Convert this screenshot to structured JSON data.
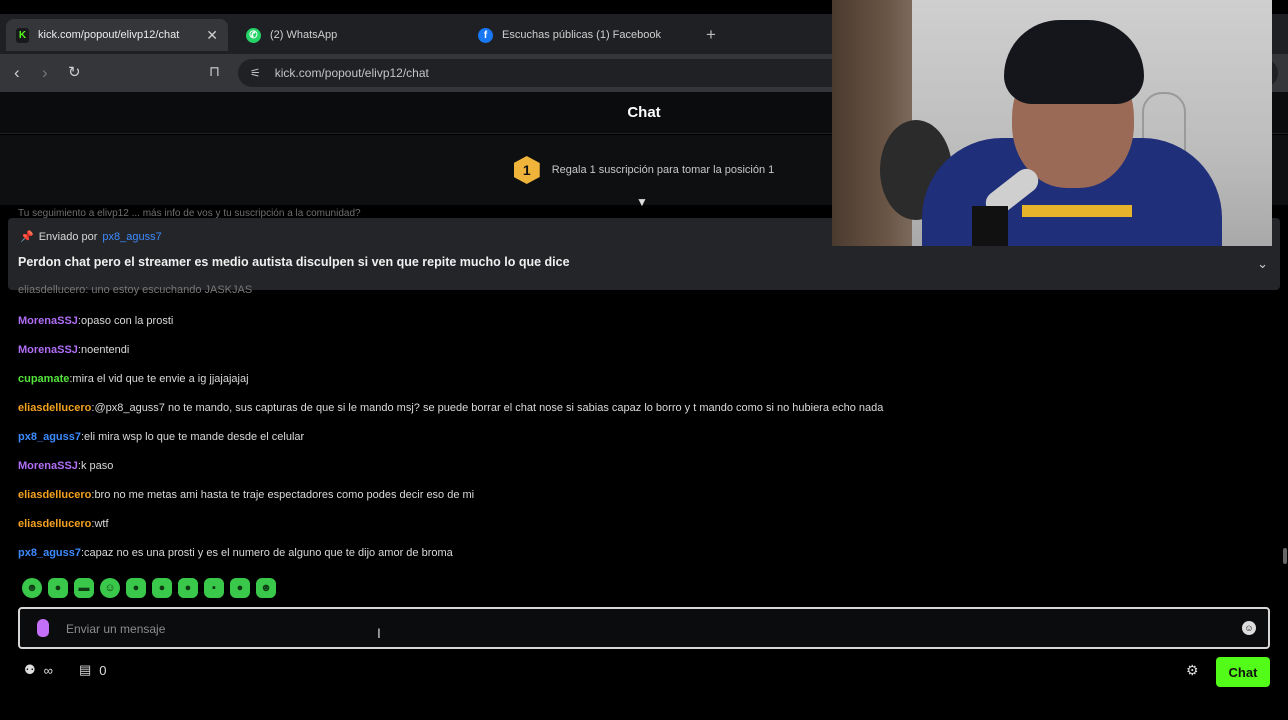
{
  "browser": {
    "tabs": [
      {
        "title": "kick.com/popout/elivp12/chat",
        "favicon": "kick-icon",
        "active": true
      },
      {
        "title": "(2) WhatsApp",
        "favicon": "whatsapp-icon",
        "active": false
      },
      {
        "title": "Escuchas públicas (1) Facebook",
        "favicon": "facebook-icon",
        "active": false
      }
    ],
    "url": "kick.com/popout/elivp12/chat"
  },
  "chat": {
    "title": "Chat",
    "goal_rank": "1",
    "goal_text": "Regala 1 suscripción para tomar la posición 1",
    "ghost_line": "Tu seguimiento a elivp12 ... más info de vos y tu suscripción a la comunidad?",
    "pinned": {
      "sent_by_label": "Enviado por",
      "user": "px8_aguss7",
      "text": "Perdon chat pero el streamer es medio autista disculpen si ven que repite mucho lo que dice"
    },
    "partial_message": "eliasdellucero: uno estoy escuchando JASKJAS",
    "messages": [
      {
        "user": "MorenaSSJ",
        "color": "purple",
        "text": "opaso con la prosti"
      },
      {
        "user": "MorenaSSJ",
        "color": "purple",
        "text": "noentendi"
      },
      {
        "user": "cupamate",
        "color": "green",
        "text": "mira el vid que te envie a ig jjajajajaj"
      },
      {
        "user": "eliasdellucero",
        "color": "orange",
        "text": "@px8_aguss7 no te mando, sus capturas de que si le mando msj? se puede borrar el chat nose si sabias capaz lo borro y t mando como si no hubiera echo nada"
      },
      {
        "user": "px8_aguss7",
        "color": "blue",
        "text": "eli mira wsp lo que te mande desde el celular"
      },
      {
        "user": "MorenaSSJ",
        "color": "purple",
        "text": "k paso"
      },
      {
        "user": "eliasdellucero",
        "color": "orange",
        "text": "bro no me metas ami hasta te traje espectadores como podes decir eso de mi"
      },
      {
        "user": "eliasdellucero",
        "color": "orange",
        "text": "wtf"
      },
      {
        "user": "px8_aguss7",
        "color": "blue",
        "text": "capaz no es una prosti y es el numero de alguno que te dijo amor de broma"
      }
    ],
    "emotes": [
      "emote-1",
      "emote-2",
      "emote-3",
      "emote-4",
      "emote-5",
      "emote-6",
      "emote-7",
      "emote-8",
      "emote-9",
      "emote-10"
    ],
    "input_placeholder": "Enviar un mensaje",
    "infinity_label": "∞",
    "subs_count": "0",
    "send_button": "Chat"
  },
  "colors": {
    "accent": "#53fc18",
    "purple": "#b06ef6",
    "green": "#53e33a",
    "orange": "#f3a11f",
    "blue": "#3d8bff"
  }
}
